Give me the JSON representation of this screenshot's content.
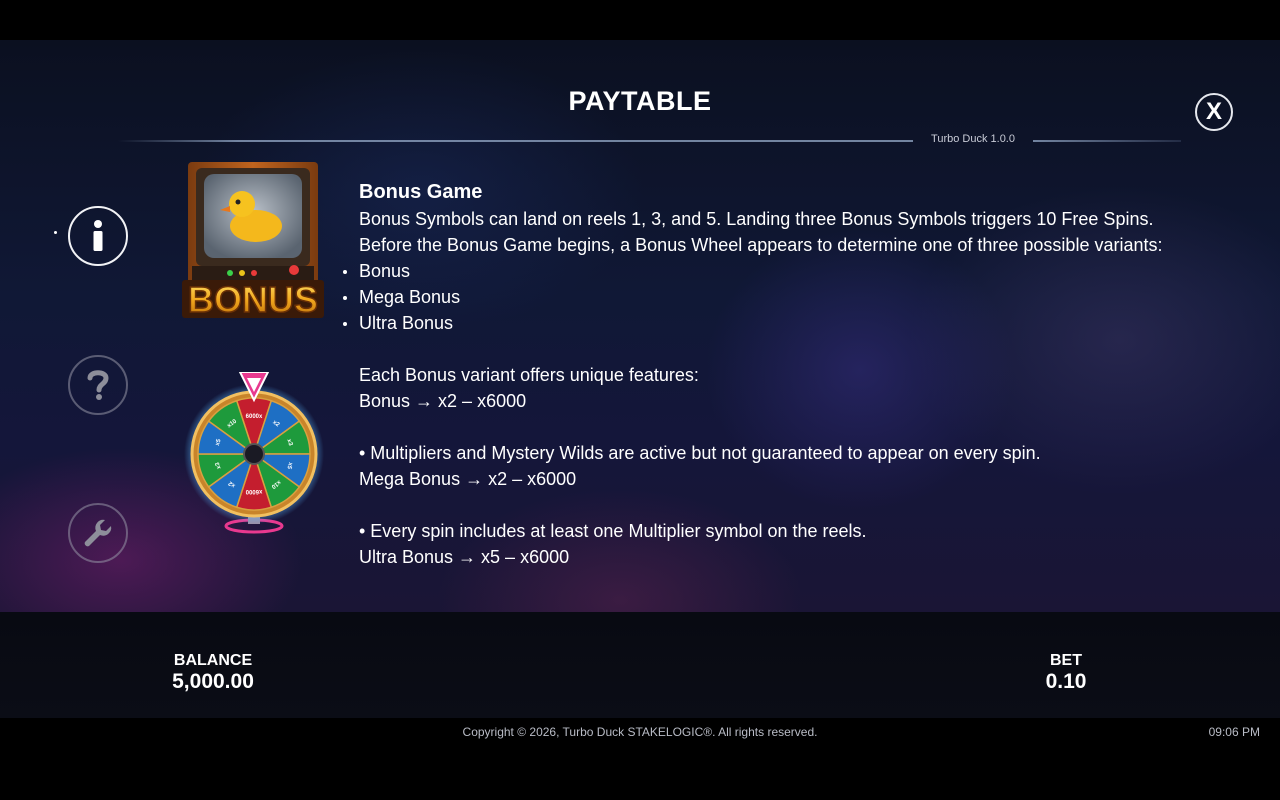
{
  "header": {
    "title": "PAYTABLE",
    "version": "Turbo Duck 1.0.0",
    "close_label": "X"
  },
  "sidebar": {
    "items": [
      {
        "icon": "info-icon",
        "active": true
      },
      {
        "icon": "help-icon",
        "active": false
      },
      {
        "icon": "wrench-icon",
        "active": false
      }
    ]
  },
  "images": {
    "bonus_symbol_text": "BONUS",
    "wheel_segments": [
      "6000x",
      "x2",
      "x3",
      "x5",
      "x10",
      "x6000",
      "x2",
      "x3",
      "x5",
      "x10"
    ]
  },
  "content": {
    "heading": "Bonus Game",
    "intro_1": "Bonus Symbols can land on reels 1, 3, and 5. Landing three Bonus Symbols triggers 10 Free Spins.",
    "intro_2": "Before the Bonus Game begins, a Bonus Wheel appears to determine one of three possible variants:",
    "variants": [
      "Bonus",
      "Mega Bonus",
      "Ultra Bonus"
    ],
    "features_intro": "Each Bonus variant offers unique features:",
    "bonus_range": "Bonus → x2 – x6000",
    "bonus_desc": "• Multipliers and Mystery Wilds are active but not guaranteed to appear on every spin.",
    "mega_range": "Mega Bonus → x2 – x6000",
    "mega_desc": "• Every spin includes at least one Multiplier symbol on the reels.",
    "ultra_range": "Ultra Bonus → x5 – x6000"
  },
  "bottom_bar": {
    "balance_label": "BALANCE",
    "balance_value": "5,000.00",
    "bet_label": "BET",
    "bet_value": "0.10"
  },
  "footer": {
    "copyright": "Copyright © 2026, Turbo Duck STAKELOGIC®. All rights reserved.",
    "time": "09:06 PM"
  },
  "colors": {
    "accent_gold": "#f2a81e",
    "wheel_blue": "#1e6fc4",
    "wheel_green": "#1e9a3c",
    "wheel_red": "#c41e2e",
    "pointer_pink": "#e8398f"
  }
}
